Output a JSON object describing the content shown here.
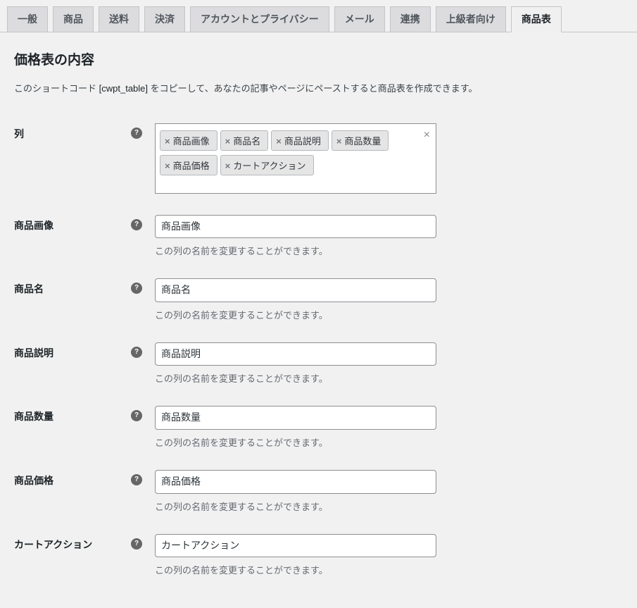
{
  "tabs": [
    {
      "label": "一般",
      "active": false
    },
    {
      "label": "商品",
      "active": false
    },
    {
      "label": "送料",
      "active": false
    },
    {
      "label": "決済",
      "active": false
    },
    {
      "label": "アカウントとプライバシー",
      "active": false
    },
    {
      "label": "メール",
      "active": false
    },
    {
      "label": "連携",
      "active": false
    },
    {
      "label": "上級者向け",
      "active": false
    },
    {
      "label": "商品表",
      "active": true
    }
  ],
  "section_title": "価格表の内容",
  "description_prefix": "このショートコード",
  "shortcode": "[cwpt_table]",
  "description_suffix": "をコピーして、あなたの記事やページにペーストすると商品表を作成できます。",
  "columns_field": {
    "label": "列",
    "tags": [
      "商品画像",
      "商品名",
      "商品説明",
      "商品数量",
      "商品価格",
      "カートアクション"
    ]
  },
  "fields": [
    {
      "label": "商品画像",
      "value": "商品画像",
      "desc": "この列の名前を変更することができます。"
    },
    {
      "label": "商品名",
      "value": "商品名",
      "desc": "この列の名前を変更することができます。"
    },
    {
      "label": "商品説明",
      "value": "商品説明",
      "desc": "この列の名前を変更することができます。"
    },
    {
      "label": "商品数量",
      "value": "商品数量",
      "desc": "この列の名前を変更することができます。"
    },
    {
      "label": "商品価格",
      "value": "商品価格",
      "desc": "この列の名前を変更することができます。"
    },
    {
      "label": "カートアクション",
      "value": "カートアクション",
      "desc": "この列の名前を変更することができます。"
    }
  ]
}
